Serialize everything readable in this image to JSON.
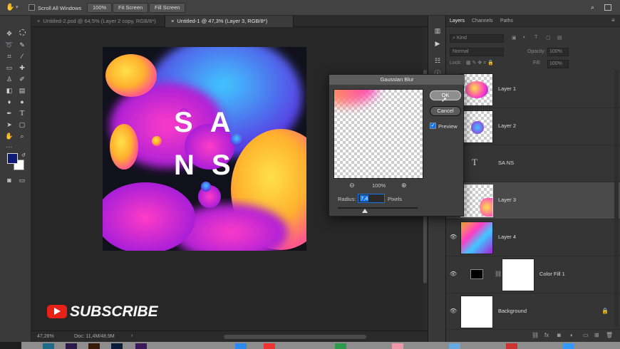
{
  "options_bar": {
    "scroll_all_windows_label": "Scroll All Windows",
    "zoom_button": "100%",
    "fit_screen_button": "Fit Screen",
    "fill_screen_button": "Fill Screen"
  },
  "tabs": [
    {
      "label": "Untitled-2.psd @ 64,5% (Layer 2 copy, RGB/8*)",
      "active": false
    },
    {
      "label": "Untitled-1 @ 47,3% (Layer 3, RGB/8*)",
      "active": true
    }
  ],
  "artwork": {
    "line1": "SA",
    "line2": "NS"
  },
  "status": {
    "zoom": "47,26%",
    "doc": "Doc: 11,4M/48,9M"
  },
  "subscribe_label": "SUBSCRIBE",
  "layers_panel": {
    "tabs": [
      "Layers",
      "Channels",
      "Paths"
    ],
    "kind_filter": "Kind",
    "blend_mode": "Normal",
    "opacity_label": "Opacity:",
    "opacity_value": "100%",
    "lock_label": "Lock:",
    "fill_label": "Fill:",
    "fill_value": "100%",
    "layers": [
      {
        "name": "Layer 1",
        "visible": false,
        "selected": false
      },
      {
        "name": "Layer 2",
        "visible": false,
        "selected": false
      },
      {
        "name": "SA NS",
        "visible": false,
        "selected": false,
        "type_glyph": "T"
      },
      {
        "name": "Layer 3",
        "visible": true,
        "selected": true
      },
      {
        "name": "Layer 4",
        "visible": true,
        "selected": false
      },
      {
        "name": "Color Fill 1",
        "visible": true,
        "selected": false
      },
      {
        "name": "Background",
        "visible": true,
        "selected": false
      }
    ]
  },
  "dialog": {
    "title": "Gaussian Blur",
    "ok_label": "OK",
    "cancel_label": "Cancel",
    "preview_label": "Preview",
    "preview_checked": true,
    "zoom": "100%",
    "radius_label": "Radius:",
    "radius_value": "7,4",
    "radius_unit": "Pixels"
  },
  "colors": {
    "foreground": "#0f1a78",
    "background": "#ffffff",
    "accent": "#1473e6"
  }
}
